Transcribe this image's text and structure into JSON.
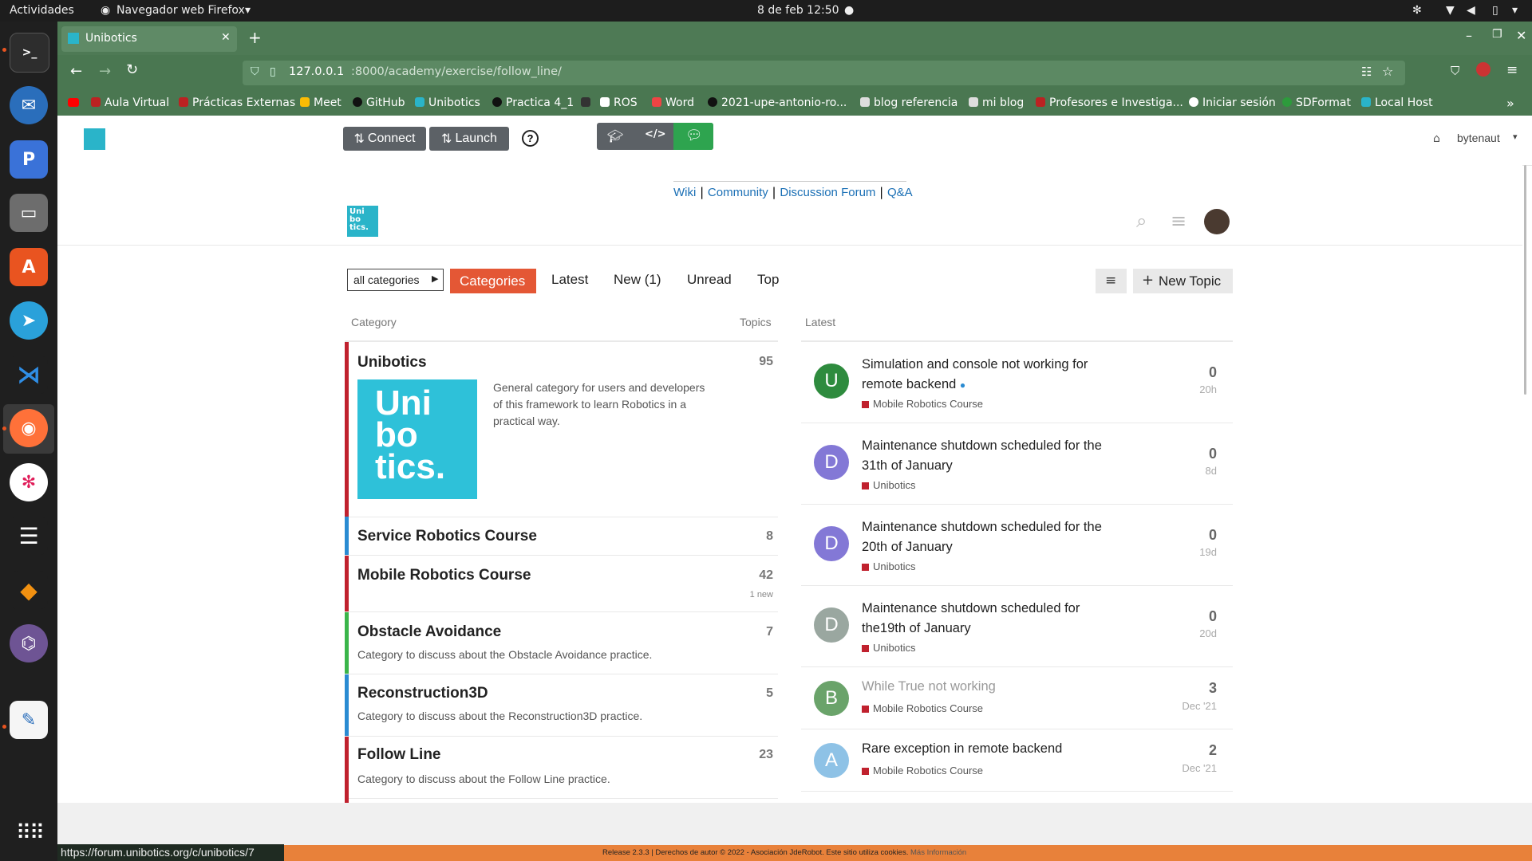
{
  "system_bar": {
    "activities": "Actividades",
    "app_name": "Navegador web Firefox",
    "datetime": "8 de feb  12:50"
  },
  "browser": {
    "tab_title": "Unibotics",
    "url_host": "127.0.0.1",
    "url_rest": ":8000/academy/exercise/follow_line/",
    "bookmarks": [
      "Aula Virtual",
      "Prácticas Externas",
      "Meet",
      "GitHub",
      "Unibotics",
      "Practica 4_1",
      "ROS",
      "Word",
      "2021-upe-antonio-ro...",
      "blog referencia",
      "mi blog",
      "Profesores e Investiga...",
      "Iniciar sesión",
      "SDFormat",
      "Local Host"
    ],
    "status_url": "https://forum.unibotics.org/c/unibotics/7"
  },
  "app": {
    "connect_label": "Connect",
    "launch_label": "Launch",
    "user_name": "bytenaut",
    "logo_text": "Uni bo tics."
  },
  "forum": {
    "links": [
      "Wiki",
      "Community",
      "Discussion Forum",
      "Q&A"
    ],
    "category_selector": "all categories",
    "tabs": [
      "Categories",
      "Latest",
      "New (1)",
      "Unread",
      "Top"
    ],
    "new_topic_label": "New Topic",
    "category_header": "Category",
    "topics_header": "Topics",
    "latest_header": "Latest",
    "categories": [
      {
        "name": "Unibotics",
        "count": "95",
        "description": "General category for users and developers of this framework to learn Robotics in a practical way.",
        "extra": "",
        "color": "#c0212e"
      },
      {
        "name": "Service Robotics Course",
        "count": "8",
        "description": "",
        "extra": "",
        "color": "#2a8bd2"
      },
      {
        "name": "Mobile Robotics Course",
        "count": "42",
        "description": "",
        "extra": "1 new",
        "color": "#c0212e"
      },
      {
        "name": "Obstacle Avoidance",
        "count": "7",
        "description": "Category to discuss about the Obstacle Avoidance practice.",
        "extra": "",
        "color": "#3ab54a"
      },
      {
        "name": "Reconstruction3D",
        "count": "5",
        "description": "Category to discuss about the Reconstruction3D practice.",
        "extra": "",
        "color": "#2a8bd2"
      },
      {
        "name": "Follow Line",
        "count": "23",
        "description": "Category to discuss about the Follow Line practice.",
        "extra": "",
        "color": "#c0212e"
      }
    ],
    "topics": [
      {
        "avatar": "U",
        "avatar_color": "#2e8b3e",
        "title": "Simulation and console not working for remote backend",
        "category": "Mobile Robotics Course",
        "replies": "0",
        "age": "20h",
        "muted": false
      },
      {
        "avatar": "D",
        "avatar_color": "#8378d6",
        "title": "Maintenance shutdown scheduled for the 31th of January",
        "category": "Unibotics",
        "replies": "0",
        "age": "8d",
        "muted": false
      },
      {
        "avatar": "D",
        "avatar_color": "#8378d6",
        "title": "Maintenance shutdown scheduled for the 20th of January",
        "category": "Unibotics",
        "replies": "0",
        "age": "19d",
        "muted": false
      },
      {
        "avatar": "D",
        "avatar_color": "#9aa7a0",
        "title": "Maintenance shutdown scheduled for the19th of January",
        "category": "Unibotics",
        "replies": "0",
        "age": "20d",
        "muted": false
      },
      {
        "avatar": "B",
        "avatar_color": "#6aa36a",
        "title": "While True not working",
        "category": "Mobile Robotics Course",
        "replies": "3",
        "age": "Dec '21",
        "muted": true
      },
      {
        "avatar": "A",
        "avatar_color": "#8ec2e6",
        "title": "Rare exception in remote backend",
        "category": "Mobile Robotics Course",
        "replies": "2",
        "age": "Dec '21",
        "muted": false
      }
    ],
    "footer": "Release 2.3.3 | Derechos de autor © 2022 - Asociación JdeRobot. Este sitio utiliza cookies.",
    "footer_link": "Más Información"
  },
  "colors": {
    "accent": "#e45735",
    "firefox_green": "#4a7751"
  }
}
